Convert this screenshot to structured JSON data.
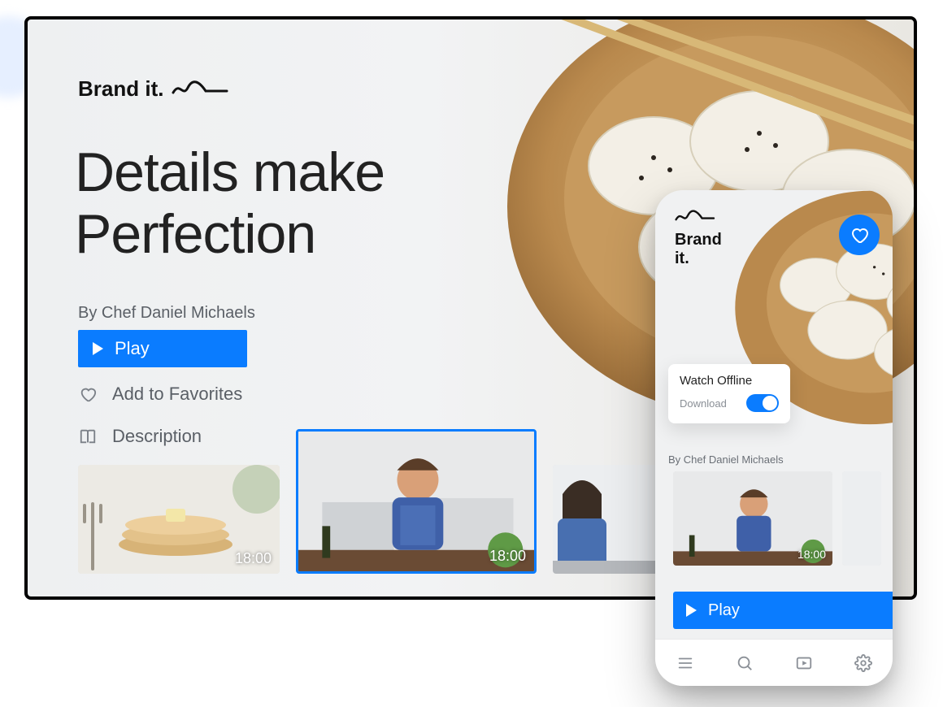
{
  "brand": {
    "name": "Brand it."
  },
  "desktop": {
    "headline_line1": "Details make",
    "headline_line2": "Perfection",
    "author": "By Chef Daniel Michaels",
    "play_label": "Play",
    "favorites_label": "Add to Favorites",
    "description_label": "Description",
    "thumbnails": [
      {
        "duration": "18:00",
        "selected": false,
        "subject": "pancakes"
      },
      {
        "duration": "18:00",
        "selected": true,
        "subject": "chef-man"
      },
      {
        "duration": "",
        "selected": false,
        "subject": "chef-woman"
      }
    ]
  },
  "mobile": {
    "brand_line1": "Brand",
    "brand_line2": "it.",
    "offline_title": "Watch Offline",
    "download_label": "Download",
    "download_on": true,
    "author": "By Chef Daniel Michaels",
    "play_label": "Play",
    "thumbnails": [
      {
        "duration": "18:00",
        "subject": "chef-man"
      },
      {
        "duration": "",
        "subject": "chef-woman"
      }
    ],
    "nav_icons": [
      "menu",
      "search",
      "video",
      "settings"
    ]
  },
  "colors": {
    "accent": "#0a7cff"
  }
}
